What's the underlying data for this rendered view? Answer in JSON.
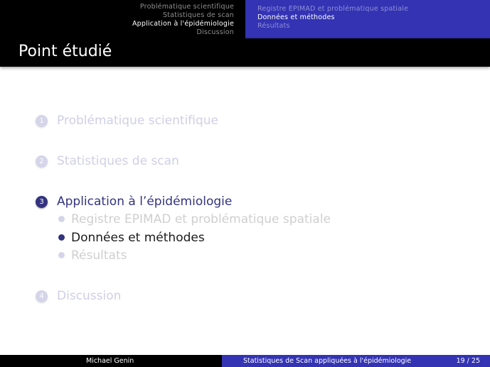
{
  "header": {
    "sections": [
      {
        "label": "Problématique scientifique",
        "active": false
      },
      {
        "label": "Statistiques de scan",
        "active": false
      },
      {
        "label": "Application à l'épidémiologie",
        "active": true
      },
      {
        "label": "Discussion",
        "active": false
      }
    ],
    "subsections": [
      {
        "label": "Registre EPIMAD et problématique spatiale",
        "active": false
      },
      {
        "label": "Données et méthodes",
        "active": true
      },
      {
        "label": "Résultats",
        "active": false
      }
    ]
  },
  "frame": {
    "title": "Point étudié"
  },
  "outline": {
    "items": [
      {
        "number": "1",
        "label": "Problématique scientifique"
      },
      {
        "number": "2",
        "label": "Statistiques de scan"
      },
      {
        "number": "3",
        "label": "Application à l’épidémiologie",
        "subitems": [
          {
            "label": "Registre EPIMAD et problématique spatiale"
          },
          {
            "label": "Données et méthodes"
          },
          {
            "label": "Résultats"
          }
        ]
      },
      {
        "number": "4",
        "label": "Discussion"
      }
    ]
  },
  "footer": {
    "author": "Michael Genin",
    "title": "Statistiques de Scan appliquées à l'épidémiologie",
    "page": "19 / 25"
  },
  "colors": {
    "structure": "#3333b3",
    "current": "#33337f",
    "dimmed": "#cfcfe6",
    "background": "#ffffff"
  }
}
